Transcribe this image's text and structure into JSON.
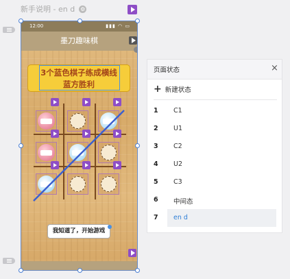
{
  "page": {
    "title": "新手说明 - en d"
  },
  "phone": {
    "status_time": "12:00",
    "nav_title": "墨刀趣味棋",
    "banner_line1": "3个蓝色棋子练成横线",
    "banner_line2": "蓝方胜利",
    "start_button": "我知道了，开始游戏"
  },
  "board": {
    "cells": [
      [
        "red",
        "empty",
        "blue"
      ],
      [
        "red",
        "blue",
        "empty"
      ],
      [
        "blue",
        "empty",
        "empty"
      ]
    ]
  },
  "state_panel": {
    "title": "页面状态",
    "close_icon": "close-icon",
    "new_state_label": "新建状态",
    "states": [
      {
        "num": "1",
        "name": "C1"
      },
      {
        "num": "2",
        "name": "U1"
      },
      {
        "num": "3",
        "name": "C2"
      },
      {
        "num": "4",
        "name": "U2"
      },
      {
        "num": "5",
        "name": "C3"
      },
      {
        "num": "6",
        "name": "中间态"
      },
      {
        "num": "7",
        "name": "en d",
        "selected": true
      }
    ]
  },
  "colors": {
    "accent": "#8e4ec6",
    "selection": "#4a90e2",
    "selected_state": "#2f7fd6"
  }
}
